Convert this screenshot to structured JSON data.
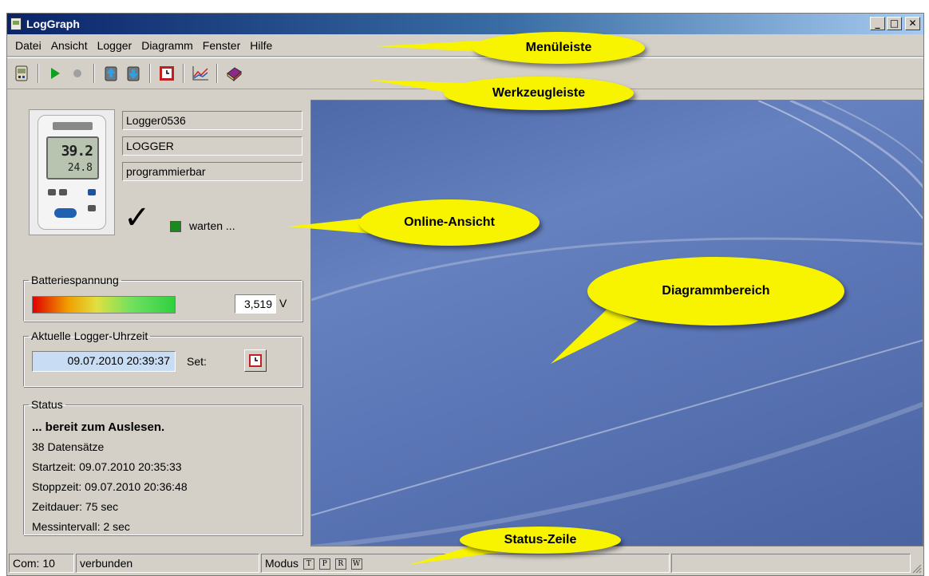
{
  "window": {
    "title": "LogGraph",
    "controls": {
      "minimize": "_",
      "maximize": "□",
      "close": "✕"
    }
  },
  "menu": {
    "items": [
      "Datei",
      "Ansicht",
      "Logger",
      "Diagramm",
      "Fenster",
      "Hilfe"
    ]
  },
  "toolbar": {
    "icons": [
      "logger-icon",
      "play-icon",
      "record-icon",
      "upload-icon",
      "download-icon",
      "clock-set-icon",
      "chart-icon",
      "book-icon"
    ]
  },
  "device": {
    "name": "Logger0536",
    "type": "LOGGER",
    "mode": "programmierbar",
    "display_big": "39.2",
    "display_small": "24.8",
    "state_text": "warten ...",
    "led_color": "#1a8a1a"
  },
  "battery": {
    "legend": "Batteriespannung",
    "value": "3,519",
    "unit": "V"
  },
  "clock": {
    "legend": "Aktuelle Logger-Uhrzeit",
    "value": "09.07.2010 20:39:37",
    "set_label": "Set:"
  },
  "status": {
    "legend": "Status",
    "headline": "... bereit zum Auslesen.",
    "records": "38 Datensätze",
    "start": "Startzeit: 09.07.2010 20:35:33",
    "stop": "Stoppzeit: 09.07.2010 20:36:48",
    "duration": "Zeitdauer: 75 sec",
    "interval": "Messintervall: 2 sec"
  },
  "statusbar": {
    "com": "Com: 10",
    "connection": "verbunden",
    "mode_label": "Modus",
    "mode_flags": [
      "T",
      "P",
      "R",
      "W"
    ]
  },
  "callouts": {
    "menu": "Menüleiste",
    "toolbar": "Werkzeugleiste",
    "online": "Online-Ansicht",
    "diagram": "Diagrammbereich",
    "statusline": "Status-Zeile"
  },
  "colors": {
    "callout": "#f8f400",
    "title_gradient_start": "#0a246a",
    "diagram_bg": "#5b76b6"
  }
}
